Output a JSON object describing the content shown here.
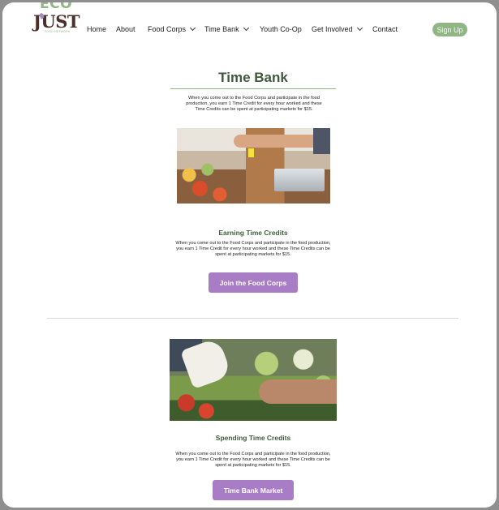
{
  "brand": {
    "logo_top": "ECO",
    "logo_main": "JUST",
    "logo_tagline": "FOOD NETWORK"
  },
  "nav": {
    "items": [
      {
        "label": "Home",
        "dropdown": false
      },
      {
        "label": "About",
        "dropdown": false
      },
      {
        "label": "Food Corps",
        "dropdown": true
      },
      {
        "label": "Time Bank",
        "dropdown": true
      },
      {
        "label": "Youth Co-Op",
        "dropdown": false
      },
      {
        "label": "Get Involved",
        "dropdown": true
      },
      {
        "label": "Contact",
        "dropdown": false
      }
    ],
    "signup_label": "Sign Up"
  },
  "page": {
    "title": "Time Bank",
    "intro": "When you come out to the Food Corps and participate in the food production, you earn 1 Time Credit for every hour worked and these Time Credits can be spent at participating markets for $15."
  },
  "sections": [
    {
      "title": "Earning Time Credits",
      "text": "When you come out to the Food Corps and participate in the food production, you earn 1 Time Credit for every hour worked and these Time Credits can be spent at participating markets for $15.",
      "button": "Join the Food Corps"
    },
    {
      "title": "Spending Time Credits",
      "text": "When you come out to the Food Corps and participate in the food production, you earn 1 Time Credit for every hour worked and these Time Credits can be spent at participating markets for $15.",
      "button": "Time Bank Market"
    }
  ],
  "colors": {
    "accent_green": "#8fb683",
    "heading_green": "#3e5a3c",
    "button_purple": "#a97cc6",
    "logo_brown": "#4a2f2a"
  },
  "icons": {
    "dropdown": "chevron-down-icon"
  }
}
